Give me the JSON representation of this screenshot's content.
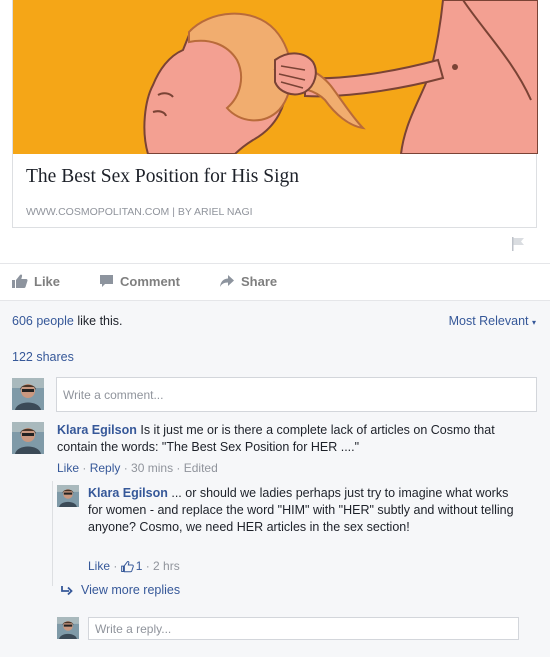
{
  "link": {
    "title": "The Best Sex Position for His Sign",
    "source": "WWW.COSMOPOLITAN.COM | BY ARIEL NAGI"
  },
  "actions": {
    "like": "Like",
    "comment": "Comment",
    "share": "Share"
  },
  "ufi": {
    "likes_count": "606 people",
    "likes_suffix": " like this.",
    "sort_label": "Most Relevant",
    "shares": "122 shares",
    "comment_placeholder": "Write a comment..."
  },
  "comments": [
    {
      "author": "Klara Egilson",
      "text": " Is it just me or is there a complete lack of articles on Cosmo that contain the words: \"The Best Sex Position for HER ....\"",
      "like": "Like",
      "reply": "Reply",
      "time": "30 mins",
      "edited": "Edited"
    }
  ],
  "reply": {
    "author": "Klara Egilson",
    "text": " ... or should we ladies perhaps just try to imagine what works for women - and replace the word \"HIM\" with \"HER\" subtly and without telling anyone? Cosmo, we need HER articles in the sex section!",
    "like": "Like",
    "like_count": "1",
    "time": "2 hrs"
  },
  "view_more_replies": "View more replies",
  "reply_placeholder": "Write a reply...",
  "colors": {
    "link_blue": "#365899",
    "image_bg": "#f5a617",
    "skin": "#f3a092",
    "hair": "#f1ad6f"
  }
}
